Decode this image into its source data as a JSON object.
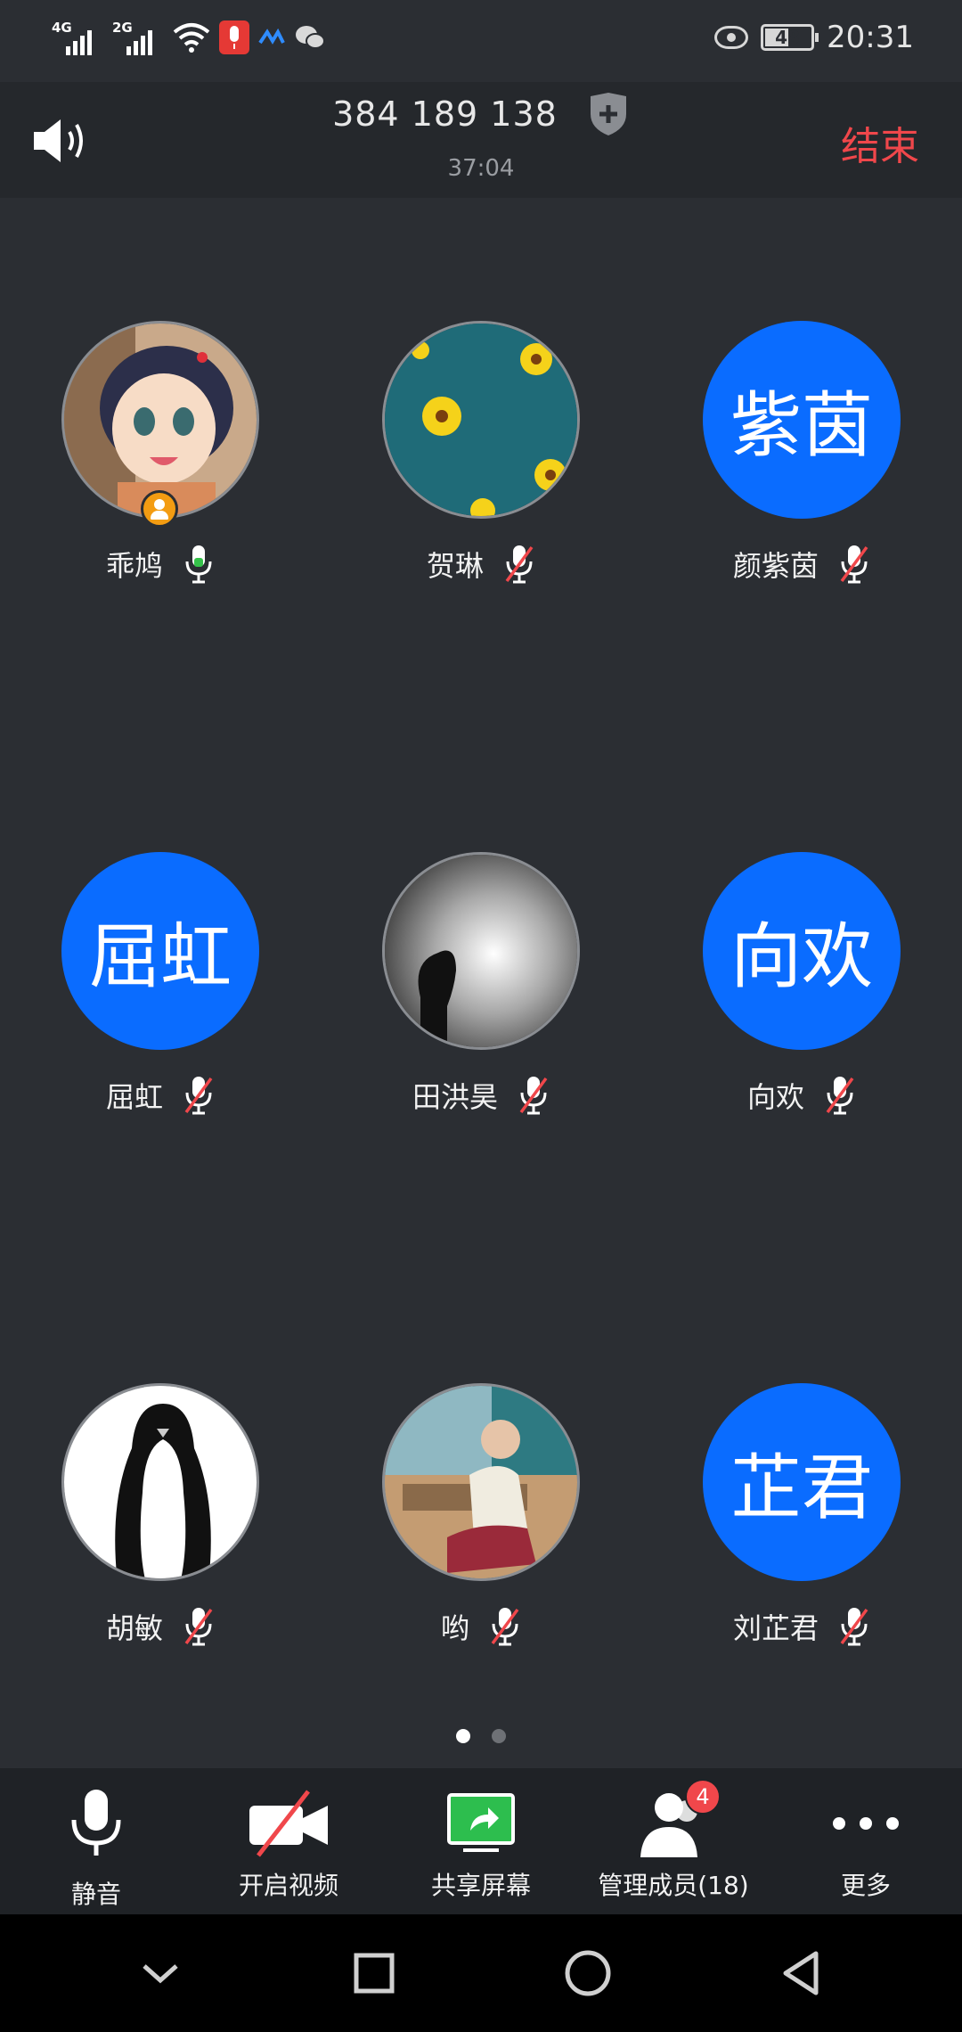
{
  "status_bar": {
    "signal1_label": "4G",
    "signal2_label": "2G",
    "battery_level": "48",
    "time": "20:31"
  },
  "header": {
    "meeting_id": "384 189 138",
    "duration": "37:04",
    "end_label": "结束"
  },
  "participants": [
    {
      "name": "乖鸠",
      "avatar_text": "",
      "mic": "on",
      "host": true
    },
    {
      "name": "贺琳",
      "avatar_text": "",
      "mic": "muted"
    },
    {
      "name": "颜紫茵",
      "avatar_text": "紫茵",
      "mic": "muted"
    },
    {
      "name": "屈虹",
      "avatar_text": "屈虹",
      "mic": "muted"
    },
    {
      "name": "田洪昊",
      "avatar_text": "",
      "mic": "muted"
    },
    {
      "name": "向欢",
      "avatar_text": "向欢",
      "mic": "muted"
    },
    {
      "name": "胡敏",
      "avatar_text": "",
      "mic": "muted"
    },
    {
      "name": "哟",
      "avatar_text": "",
      "mic": "muted"
    },
    {
      "name": "刘芷君",
      "avatar_text": "芷君",
      "mic": "muted"
    }
  ],
  "pagination": {
    "pages": 2,
    "current": 1
  },
  "toolbar": {
    "mute_label": "静音",
    "video_label": "开启视频",
    "share_label": "共享屏幕",
    "members_label": "管理成员(18)",
    "members_badge": "4",
    "more_label": "更多"
  },
  "colors": {
    "background": "#2b2e33",
    "avatar_blue": "#0a6cff",
    "end_red": "#f0474b",
    "mic_on_green": "#35c24a",
    "mute_red": "#f0474b",
    "share_green": "#2dbe4e"
  }
}
